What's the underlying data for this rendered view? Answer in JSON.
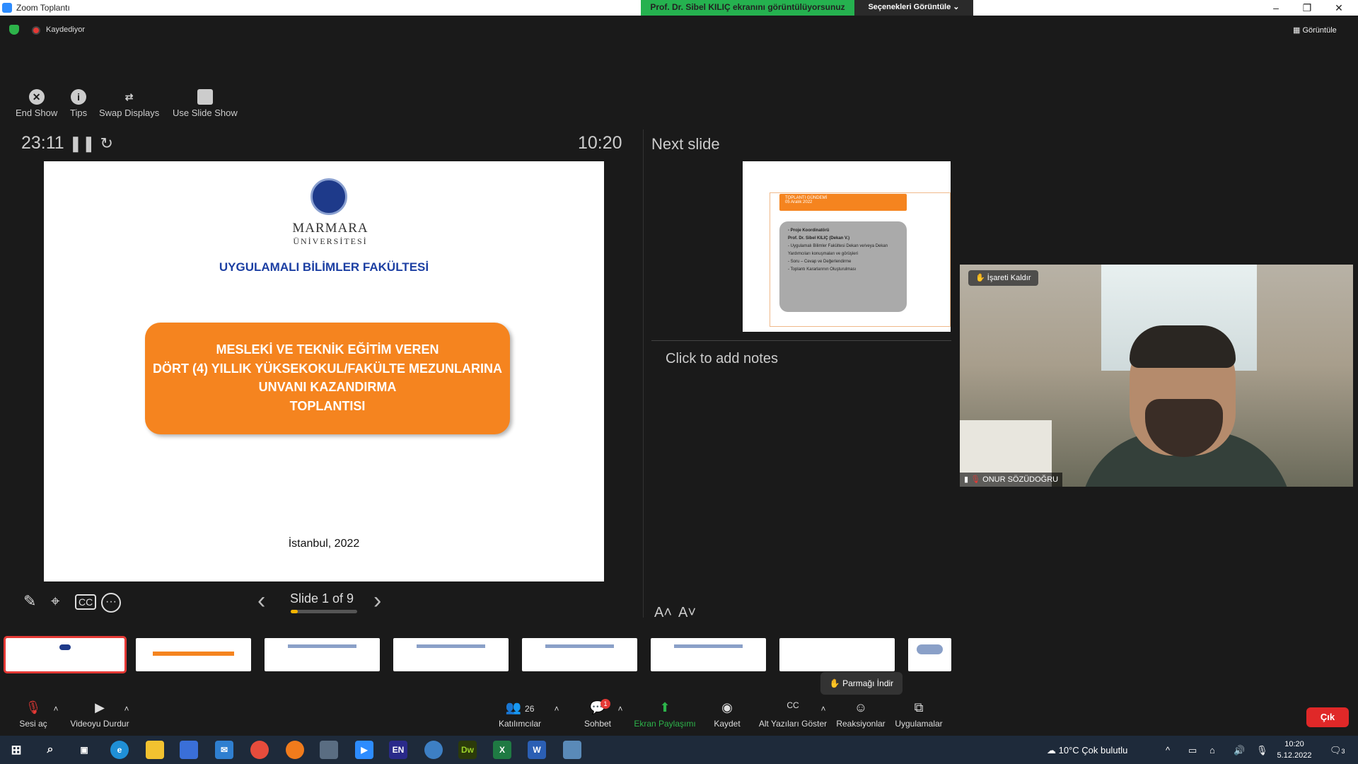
{
  "window": {
    "title": "Zoom Toplantı"
  },
  "share_banner": {
    "text": "Prof. Dr. Sibel KILIÇ ekranını görüntülüyorsunuz",
    "view_options": "Seçenekleri Görüntüle ⌄"
  },
  "status": {
    "recording": "Kaydediyor",
    "view": "Görüntüle"
  },
  "ppt_toolbar": {
    "end_show": "End Show",
    "tips": "Tips",
    "swap": "Swap Displays",
    "use_slide_show": "Use Slide Show"
  },
  "presenter": {
    "timer": "23:11",
    "clock": "10:20",
    "next_slide_title": "Next slide",
    "notes_placeholder": "Click to add notes",
    "slide_counter": "Slide 1 of 9",
    "progress_fraction": 0.11
  },
  "slide": {
    "university_line1": "MARMARA",
    "university_line2": "ÜNİVERSİTESİ",
    "faculty": "UYGULAMALI BİLİMLER FAKÜLTESİ",
    "box_lines": [
      "MESLEKİ VE TEKNİK EĞİTİM VEREN",
      "DÖRT (4) YILLIK YÜKSEKOKUL/FAKÜLTE MEZUNLARINA",
      "UNVANI KAZANDIRMA",
      "TOPLANTISI"
    ],
    "place": "İstanbul, 2022"
  },
  "next_slide": {
    "header": "TOPLANTI GÜNDEMİ\n05 Aralık 2022",
    "items": [
      "- Proje Koordinatörü",
      "Prof. Dr. Sibel KILIÇ (Dekan V.)",
      "- Uygulamalı Bilimler Fakültesi Dekan ve/veya Dekan Yardımcıları konuşmaları ve görüşleri",
      "- Soru – Cevap ve Değerlendirme",
      "- Toplantı Kararlarının Oluşturulması"
    ]
  },
  "video": {
    "lower_hand": "İşareti Kaldır",
    "participant_name": "ONUR SÖZÜDOĞRU"
  },
  "raise_hand_pill": "Parmağı İndir",
  "controls": {
    "unmute": "Sesi aç",
    "stop_video": "Videoyu Durdur",
    "participants": "Katılımcılar",
    "participants_count": "26",
    "chat": "Sohbet",
    "chat_badge": "1",
    "share": "Ekran Paylaşımı",
    "record": "Kaydet",
    "captions": "Alt Yazıları Göster",
    "reactions": "Reaksiyonlar",
    "apps": "Uygulamalar",
    "leave": "Çık"
  },
  "taskbar": {
    "weather": "10°C  Çok bulutlu",
    "time": "10:20",
    "date": "5.12.2022",
    "notif_count": "3"
  },
  "colors": {
    "accent_orange": "#f5841f",
    "share_green": "#25b14f",
    "leave_red": "#e02828"
  }
}
